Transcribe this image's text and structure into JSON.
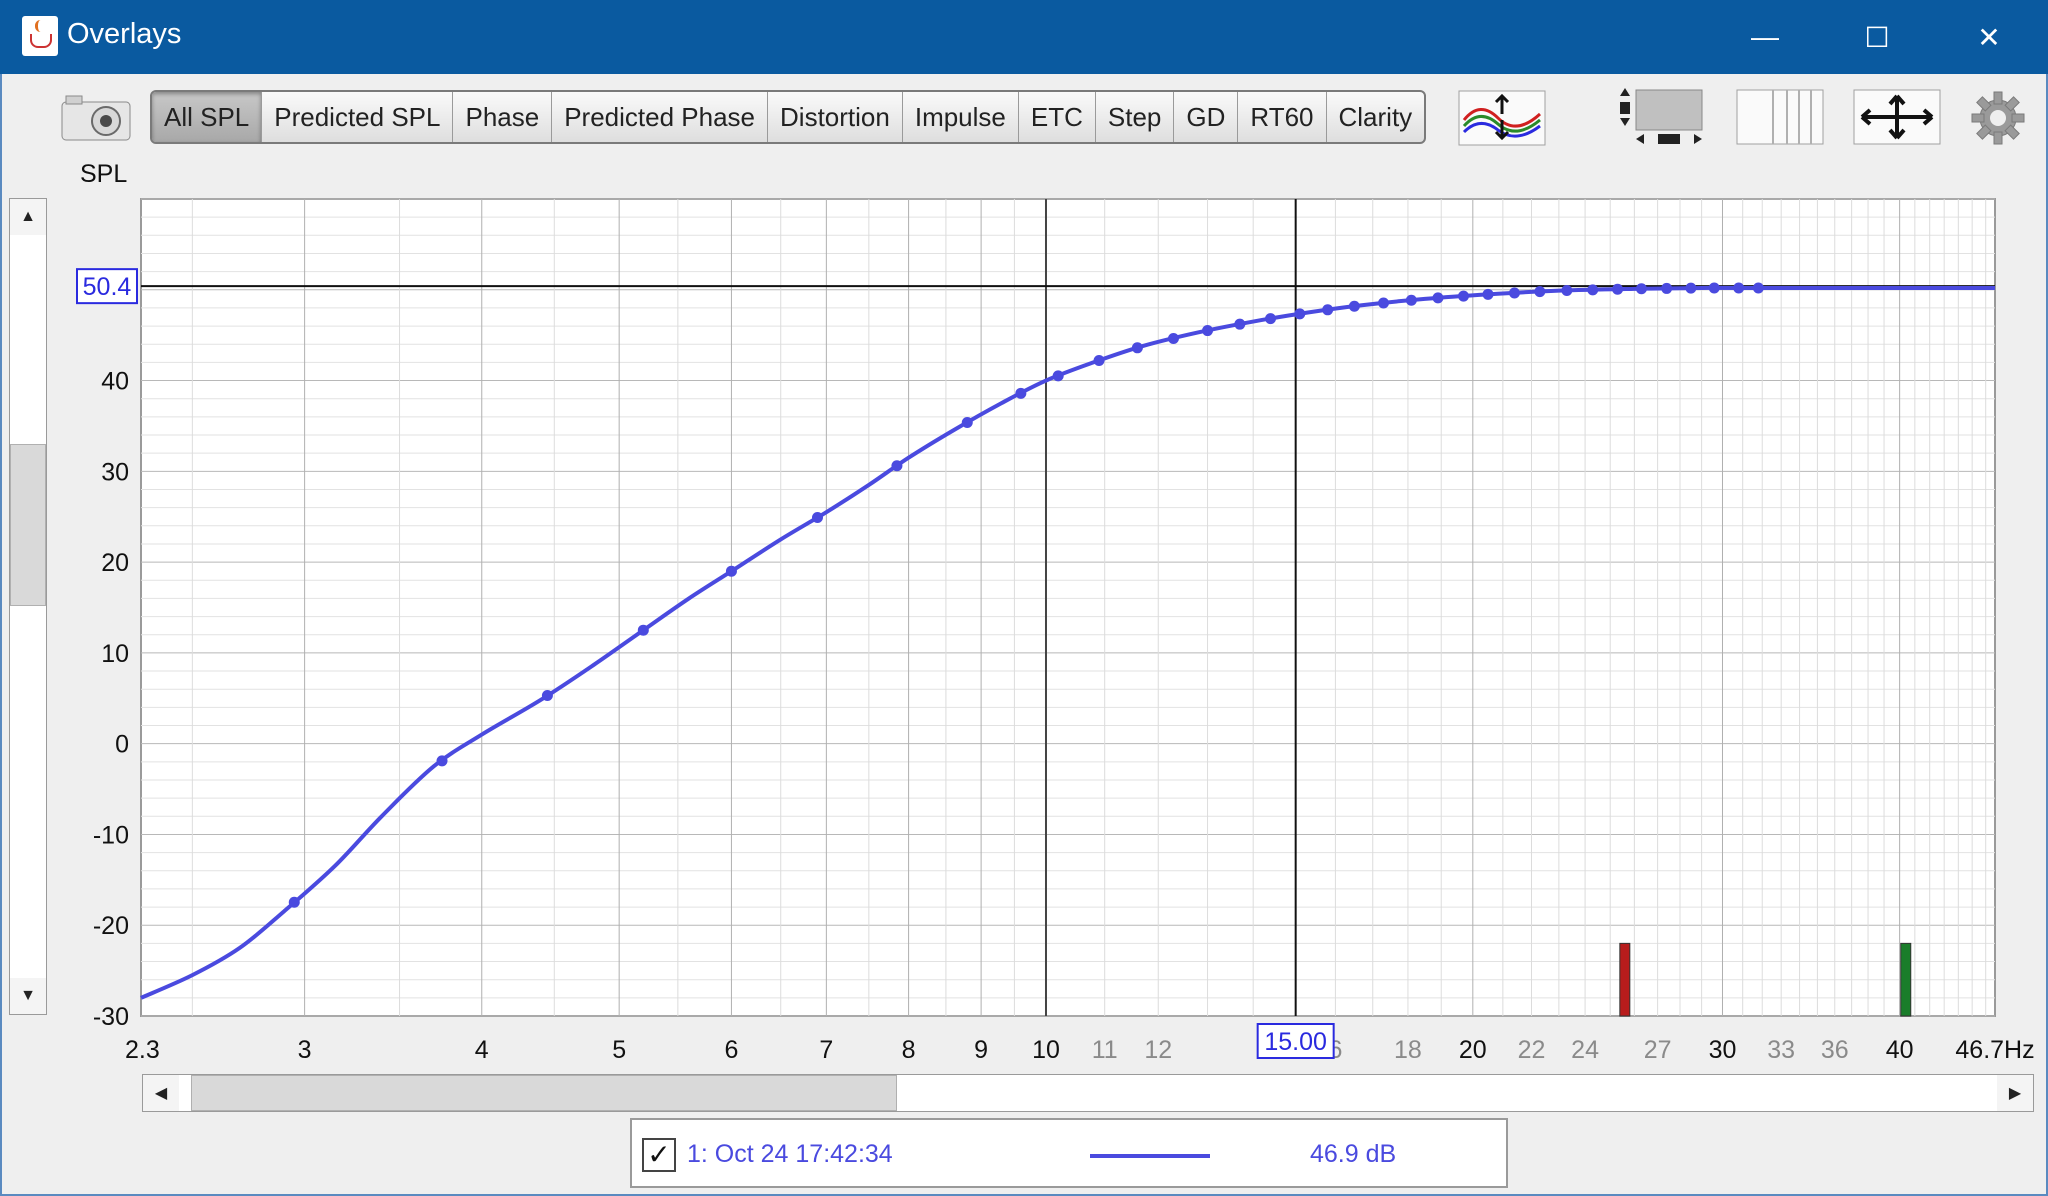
{
  "window": {
    "title": "Overlays",
    "minimize": "—",
    "maximize": "☐",
    "close": "✕"
  },
  "toolbar": {
    "tabs": [
      {
        "label": "All SPL",
        "active": true
      },
      {
        "label": "Predicted SPL"
      },
      {
        "label": "Phase"
      },
      {
        "label": "Predicted Phase"
      },
      {
        "label": "Distortion"
      },
      {
        "label": "Impulse"
      },
      {
        "label": "ETC"
      },
      {
        "label": "Step"
      },
      {
        "label": "GD"
      },
      {
        "label": "RT60"
      },
      {
        "label": "Clarity"
      }
    ],
    "icons": [
      "camera-icon",
      "trace-arrange-icon",
      "vertical-resize-icon",
      "columns-icon",
      "pan-arrows-icon",
      "gear-icon"
    ]
  },
  "y_axis_title": "SPL",
  "cursor": {
    "y_value": "50.4",
    "x_value": "15.00"
  },
  "legend": {
    "checked": true,
    "check_glyph": "✓",
    "name": "1: Oct 24 17:42:34",
    "value": "46.9 dB",
    "color": "#4a4adf"
  },
  "chart_data": {
    "type": "line",
    "x_scale": "log",
    "xlim": [
      2.3,
      46.7
    ],
    "ylim": [
      -30,
      60
    ],
    "x_unit": "Hz",
    "y_ticks": [
      "40",
      "30",
      "20",
      "10",
      "0",
      "-10",
      "-20",
      "-30"
    ],
    "y_tick_values": [
      40,
      30,
      20,
      10,
      0,
      -10,
      -20,
      -30
    ],
    "x_ticks": [
      {
        "v": 2.3,
        "label": "2.3",
        "major": true
      },
      {
        "v": 3,
        "label": "3",
        "major": true
      },
      {
        "v": 4,
        "label": "4",
        "major": true
      },
      {
        "v": 5,
        "label": "5",
        "major": true
      },
      {
        "v": 6,
        "label": "6",
        "major": true
      },
      {
        "v": 7,
        "label": "7",
        "major": true
      },
      {
        "v": 8,
        "label": "8",
        "major": true
      },
      {
        "v": 9,
        "label": "9",
        "major": true
      },
      {
        "v": 10,
        "label": "10",
        "major": true
      },
      {
        "v": 11,
        "label": "11",
        "major": false
      },
      {
        "v": 12,
        "label": "12",
        "major": false
      },
      {
        "v": 16,
        "label": "6",
        "major": false
      },
      {
        "v": 18,
        "label": "18",
        "major": false
      },
      {
        "v": 20,
        "label": "20",
        "major": true
      },
      {
        "v": 22,
        "label": "22",
        "major": false
      },
      {
        "v": 24,
        "label": "24",
        "major": false
      },
      {
        "v": 27,
        "label": "27",
        "major": false
      },
      {
        "v": 30,
        "label": "30",
        "major": true
      },
      {
        "v": 33,
        "label": "33",
        "major": false
      },
      {
        "v": 36,
        "label": "36",
        "major": false
      },
      {
        "v": 40,
        "label": "40",
        "major": true
      },
      {
        "v": 46.7,
        "label": "46.7Hz",
        "major": true
      }
    ],
    "cursor": {
      "x": 15.0,
      "y": 50.4
    },
    "series": [
      {
        "color": "#4a4adf",
        "points": [
          [
            2.3,
            -28
          ],
          [
            2.5,
            -25.5
          ],
          [
            2.7,
            -22.5
          ],
          [
            2.9,
            -18.5
          ],
          [
            3.15,
            -13.5
          ],
          [
            3.4,
            -8
          ],
          [
            3.7,
            -2.5
          ],
          [
            4.0,
            1
          ],
          [
            4.4,
            4.8
          ],
          [
            4.8,
            8.7
          ],
          [
            5.2,
            12.5
          ],
          [
            5.6,
            16
          ],
          [
            6.0,
            19
          ],
          [
            6.5,
            22.5
          ],
          [
            7.0,
            25.5
          ],
          [
            7.5,
            28.5
          ],
          [
            8.0,
            31.5
          ],
          [
            8.6,
            34.5
          ],
          [
            9.3,
            37.5
          ],
          [
            10.0,
            40
          ],
          [
            10.8,
            42
          ],
          [
            11.7,
            43.8
          ],
          [
            12.8,
            45.3
          ],
          [
            14.0,
            46.5
          ],
          [
            15.3,
            47.5
          ],
          [
            16.7,
            48.3
          ],
          [
            18.5,
            49
          ],
          [
            20.5,
            49.5
          ],
          [
            23,
            49.9
          ],
          [
            26,
            50.1
          ],
          [
            29,
            50.2
          ],
          [
            31,
            50.2
          ],
          [
            46.7,
            50.2
          ]
        ]
      }
    ],
    "markers_x": [
      2.95,
      3.75,
      4.45,
      5.2,
      6.0,
      6.9,
      7.85,
      8.8,
      9.6,
      10.2,
      10.9,
      11.6,
      12.3,
      13.0,
      13.7,
      14.4,
      15.1,
      15.8,
      16.5,
      17.3,
      18.1,
      18.9,
      19.7,
      20.5,
      21.4,
      22.3,
      23.3,
      24.3,
      25.3,
      26.3,
      27.4,
      28.5,
      29.6,
      30.8,
      31.8
    ],
    "bars": [
      {
        "x": 25.6,
        "top": -22,
        "color": "#b81c1c"
      },
      {
        "x": 40.4,
        "top": -22,
        "color": "#1a7d2a"
      }
    ]
  }
}
